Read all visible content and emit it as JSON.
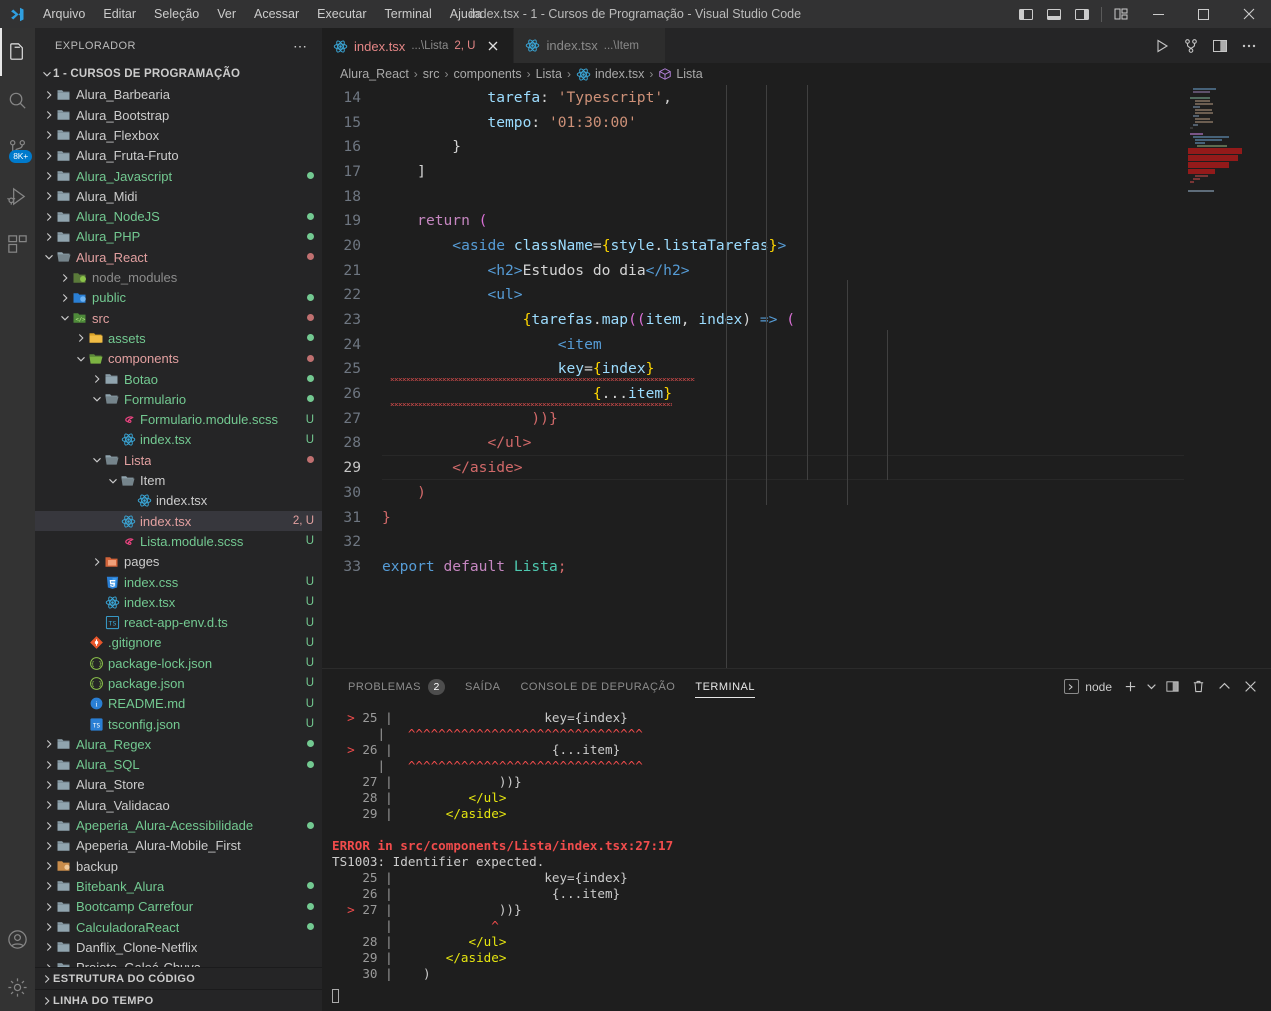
{
  "window": {
    "title": "index.tsx - 1 - Cursos de Programação - Visual Studio Code",
    "menu": [
      "Arquivo",
      "Editar",
      "Seleção",
      "Ver",
      "Acessar",
      "Executar",
      "Terminal",
      "Ajuda"
    ],
    "controls": {
      "panel_left": "toggle-primary-sidebar",
      "panel_bottom": "toggle-panel",
      "panel_right": "toggle-secondary-sidebar",
      "customize_layout": "customize-layout",
      "minimize": "—",
      "maximize": "▢",
      "close": "✕"
    }
  },
  "activitybar": {
    "items": [
      {
        "name": "explorer",
        "active": true,
        "badge": ""
      },
      {
        "name": "search",
        "active": false,
        "badge": ""
      },
      {
        "name": "source-control",
        "active": false,
        "badge": "8K+"
      },
      {
        "name": "run-and-debug",
        "active": false,
        "badge": ""
      },
      {
        "name": "extensions",
        "active": false,
        "badge": ""
      }
    ],
    "bottom": [
      {
        "name": "accounts"
      },
      {
        "name": "manage-settings"
      }
    ]
  },
  "sidebar": {
    "header": "EXPLORADOR",
    "more_actions": "⋯",
    "root": "1 - CURSOS DE PROGRAMAÇÃO",
    "sections": [
      "ESTRUTURA DO CÓDIGO",
      "LINHA DO TEMPO"
    ],
    "tree": [
      {
        "label": "Alura_Barbearia",
        "indent": 0,
        "type": "folder",
        "open": false,
        "color": "#cccccc",
        "status": "",
        "icon": "folder"
      },
      {
        "label": "Alura_Bootstrap",
        "indent": 0,
        "type": "folder",
        "open": false,
        "color": "#cccccc",
        "status": "",
        "icon": "folder"
      },
      {
        "label": "Alura_Flexbox",
        "indent": 0,
        "type": "folder",
        "open": false,
        "color": "#cccccc",
        "status": "",
        "icon": "folder"
      },
      {
        "label": "Alura_Fruta-Fruto",
        "indent": 0,
        "type": "folder",
        "open": false,
        "color": "#cccccc",
        "status": "",
        "icon": "folder"
      },
      {
        "label": "Alura_Javascript",
        "indent": 0,
        "type": "folder",
        "open": false,
        "color": "#73c991",
        "status": "dot-green",
        "icon": "folder"
      },
      {
        "label": "Alura_Midi",
        "indent": 0,
        "type": "folder",
        "open": false,
        "color": "#cccccc",
        "status": "",
        "icon": "folder"
      },
      {
        "label": "Alura_NodeJS",
        "indent": 0,
        "type": "folder",
        "open": false,
        "color": "#73c991",
        "status": "dot-green",
        "icon": "folder"
      },
      {
        "label": "Alura_PHP",
        "indent": 0,
        "type": "folder",
        "open": false,
        "color": "#73c991",
        "status": "dot-green",
        "icon": "folder"
      },
      {
        "label": "Alura_React",
        "indent": 0,
        "type": "folder",
        "open": true,
        "color": "#e2a0a0",
        "status": "dot-red",
        "icon": "folder-open"
      },
      {
        "label": "node_modules",
        "indent": 1,
        "type": "folder",
        "open": false,
        "color": "#8c8c8c",
        "status": "",
        "icon": "folder-node"
      },
      {
        "label": "public",
        "indent": 1,
        "type": "folder",
        "open": false,
        "color": "#73c991",
        "status": "dot-green",
        "icon": "folder-public"
      },
      {
        "label": "src",
        "indent": 1,
        "type": "folder",
        "open": true,
        "color": "#e2a0a0",
        "status": "dot-red",
        "icon": "folder-src"
      },
      {
        "label": "assets",
        "indent": 2,
        "type": "folder",
        "open": false,
        "color": "#73c991",
        "status": "dot-green",
        "icon": "folder-assets"
      },
      {
        "label": "components",
        "indent": 2,
        "type": "folder",
        "open": true,
        "color": "#e2a0a0",
        "status": "dot-red",
        "icon": "folder-components"
      },
      {
        "label": "Botao",
        "indent": 3,
        "type": "folder",
        "open": false,
        "color": "#73c991",
        "status": "dot-green",
        "icon": "folder"
      },
      {
        "label": "Formulario",
        "indent": 3,
        "type": "folder",
        "open": true,
        "color": "#73c991",
        "status": "dot-green",
        "icon": "folder-open"
      },
      {
        "label": "Formulario.module.scss",
        "indent": 4,
        "type": "file",
        "open": false,
        "color": "#73c991",
        "status": "U",
        "icon": "sass"
      },
      {
        "label": "index.tsx",
        "indent": 4,
        "type": "file",
        "open": false,
        "color": "#73c991",
        "status": "U",
        "icon": "react"
      },
      {
        "label": "Lista",
        "indent": 3,
        "type": "folder",
        "open": true,
        "color": "#e2a0a0",
        "status": "dot-red",
        "icon": "folder-open"
      },
      {
        "label": "Item",
        "indent": 4,
        "type": "folder",
        "open": true,
        "color": "#cccccc",
        "status": "",
        "icon": "folder-open"
      },
      {
        "label": "index.tsx",
        "indent": 5,
        "type": "file",
        "open": false,
        "color": "#cccccc",
        "status": "",
        "icon": "react"
      },
      {
        "label": "index.tsx",
        "indent": 4,
        "type": "file",
        "open": false,
        "color": "#e2a0a0",
        "status": "2, U",
        "icon": "react",
        "selected": true
      },
      {
        "label": "Lista.module.scss",
        "indent": 4,
        "type": "file",
        "open": false,
        "color": "#73c991",
        "status": "U",
        "icon": "sass"
      },
      {
        "label": "pages",
        "indent": 3,
        "type": "folder",
        "open": false,
        "color": "#cccccc",
        "status": "",
        "icon": "folder-pages"
      },
      {
        "label": "index.css",
        "indent": 3,
        "type": "file",
        "open": false,
        "color": "#73c991",
        "status": "U",
        "icon": "css"
      },
      {
        "label": "index.tsx",
        "indent": 3,
        "type": "file",
        "open": false,
        "color": "#73c991",
        "status": "U",
        "icon": "react"
      },
      {
        "label": "react-app-env.d.ts",
        "indent": 3,
        "type": "file",
        "open": false,
        "color": "#73c991",
        "status": "U",
        "icon": "ts"
      },
      {
        "label": ".gitignore",
        "indent": 2,
        "type": "file",
        "open": false,
        "color": "#73c991",
        "status": "U",
        "icon": "git"
      },
      {
        "label": "package-lock.json",
        "indent": 2,
        "type": "file",
        "open": false,
        "color": "#73c991",
        "status": "U",
        "icon": "npm"
      },
      {
        "label": "package.json",
        "indent": 2,
        "type": "file",
        "open": false,
        "color": "#73c991",
        "status": "U",
        "icon": "npm"
      },
      {
        "label": "README.md",
        "indent": 2,
        "type": "file",
        "open": false,
        "color": "#73c991",
        "status": "U",
        "icon": "info"
      },
      {
        "label": "tsconfig.json",
        "indent": 2,
        "type": "file",
        "open": false,
        "color": "#73c991",
        "status": "U",
        "icon": "tsconfig"
      },
      {
        "label": "Alura_Regex",
        "indent": 0,
        "type": "folder",
        "open": false,
        "color": "#73c991",
        "status": "dot-green",
        "icon": "folder"
      },
      {
        "label": "Alura_SQL",
        "indent": 0,
        "type": "folder",
        "open": false,
        "color": "#73c991",
        "status": "dot-green",
        "icon": "folder"
      },
      {
        "label": "Alura_Store",
        "indent": 0,
        "type": "folder",
        "open": false,
        "color": "#cccccc",
        "status": "",
        "icon": "folder"
      },
      {
        "label": "Alura_Validacao",
        "indent": 0,
        "type": "folder",
        "open": false,
        "color": "#cccccc",
        "status": "",
        "icon": "folder"
      },
      {
        "label": "Apeperia_Alura-Acessibilidade",
        "indent": 0,
        "type": "folder",
        "open": false,
        "color": "#73c991",
        "status": "dot-green",
        "icon": "folder"
      },
      {
        "label": "Apeperia_Alura-Mobile_First",
        "indent": 0,
        "type": "folder",
        "open": false,
        "color": "#cccccc",
        "status": "",
        "icon": "folder"
      },
      {
        "label": "backup",
        "indent": 0,
        "type": "folder",
        "open": false,
        "color": "#cccccc",
        "status": "",
        "icon": "folder-backup"
      },
      {
        "label": "Bitebank_Alura",
        "indent": 0,
        "type": "folder",
        "open": false,
        "color": "#73c991",
        "status": "dot-green",
        "icon": "folder"
      },
      {
        "label": "Bootcamp Carrefour",
        "indent": 0,
        "type": "folder",
        "open": false,
        "color": "#73c991",
        "status": "dot-green",
        "icon": "folder"
      },
      {
        "label": "CalculadoraReact",
        "indent": 0,
        "type": "folder",
        "open": false,
        "color": "#73c991",
        "status": "dot-green",
        "icon": "folder"
      },
      {
        "label": "Danflix_Clone-Netflix",
        "indent": 0,
        "type": "folder",
        "open": false,
        "color": "#cccccc",
        "status": "",
        "icon": "folder"
      },
      {
        "label": "Projeto_Galoá-Chuva",
        "indent": 0,
        "type": "folder",
        "open": false,
        "color": "#cccccc",
        "status": "",
        "icon": "folder"
      }
    ]
  },
  "editor": {
    "tabs": [
      {
        "label": "index.tsx",
        "desc": "...\\Lista",
        "badge": "2, U",
        "active": true,
        "icon": "react",
        "closable": true
      },
      {
        "label": "index.tsx",
        "desc": "...\\Item",
        "badge": "",
        "active": false,
        "icon": "react",
        "closable": false
      }
    ],
    "actions": [
      "run-icon",
      "source-control-fork-icon",
      "split-editor-icon",
      "more-actions-icon"
    ],
    "breadcrumb": [
      "Alura_React",
      "src",
      "components",
      "Lista",
      "index.tsx",
      "Lista"
    ],
    "breadcrumb_sep": "›",
    "current_line": 29,
    "lines": [
      {
        "n": 14,
        "text": "            tarefa: 'Typescript',"
      },
      {
        "n": 15,
        "text": "            tempo: '01:30:00'"
      },
      {
        "n": 16,
        "text": "        }"
      },
      {
        "n": 17,
        "text": "    ]"
      },
      {
        "n": 18,
        "text": ""
      },
      {
        "n": 19,
        "text": "    return ("
      },
      {
        "n": 20,
        "text": "        <aside className={style.listaTarefas}>"
      },
      {
        "n": 21,
        "text": "            <h2>Estudos do dia</h2>"
      },
      {
        "n": 22,
        "text": "            <ul>"
      },
      {
        "n": 23,
        "text": "                {tarefas.map((item, index) => ("
      },
      {
        "n": 24,
        "text": "                    <item"
      },
      {
        "n": 25,
        "text": "                    key={index}"
      },
      {
        "n": 26,
        "text": "                        {...item}"
      },
      {
        "n": 27,
        "text": "                 ))}"
      },
      {
        "n": 28,
        "text": "            </ul>"
      },
      {
        "n": 29,
        "text": "        </aside>"
      },
      {
        "n": 30,
        "text": "    )"
      },
      {
        "n": 31,
        "text": "}"
      },
      {
        "n": 32,
        "text": ""
      },
      {
        "n": 33,
        "text": "export default Lista;"
      }
    ]
  },
  "panel": {
    "tabs": [
      {
        "label": "PROBLEMAS",
        "count": "2",
        "active": false
      },
      {
        "label": "SAÍDA",
        "count": "",
        "active": false
      },
      {
        "label": "CONSOLE DE DEPURAÇÃO",
        "count": "",
        "active": false
      },
      {
        "label": "TERMINAL",
        "count": "",
        "active": true
      }
    ],
    "terminal_selector": "node",
    "actions": [
      "new-terminal-icon",
      "terminal-dropdown-icon",
      "split-terminal-icon",
      "kill-terminal-icon",
      "maximize-panel-icon",
      "close-panel-icon"
    ],
    "terminal_lines": [
      {
        "segments": [
          {
            "t": "  > ",
            "c": "tm-red"
          },
          {
            "t": "25 ",
            "c": "tm-gray"
          },
          {
            "t": "|",
            "c": "tm-gray"
          },
          {
            "t": "                    key={index}",
            "c": "tm-white"
          }
        ]
      },
      {
        "segments": [
          {
            "t": "      ",
            "c": "tm-gray"
          },
          {
            "t": "|",
            "c": "tm-gray"
          },
          {
            "t": "   ^^^^^^^^^^^^^^^^^^^^^^^^^^^^^^^",
            "c": "tm-red"
          }
        ]
      },
      {
        "segments": [
          {
            "t": "  > ",
            "c": "tm-red"
          },
          {
            "t": "26 ",
            "c": "tm-gray"
          },
          {
            "t": "|",
            "c": "tm-gray"
          },
          {
            "t": "                     {...item}",
            "c": "tm-white"
          }
        ]
      },
      {
        "segments": [
          {
            "t": "      ",
            "c": "tm-gray"
          },
          {
            "t": "|",
            "c": "tm-gray"
          },
          {
            "t": "   ^^^^^^^^^^^^^^^^^^^^^^^^^^^^^^^",
            "c": "tm-red"
          }
        ]
      },
      {
        "segments": [
          {
            "t": "    27 ",
            "c": "tm-gray"
          },
          {
            "t": "|",
            "c": "tm-gray"
          },
          {
            "t": "              ))}",
            "c": "tm-white"
          }
        ]
      },
      {
        "segments": [
          {
            "t": "    28 ",
            "c": "tm-gray"
          },
          {
            "t": "|",
            "c": "tm-gray"
          },
          {
            "t": "          </ul>",
            "c": "tm-yel"
          }
        ]
      },
      {
        "segments": [
          {
            "t": "    29 ",
            "c": "tm-gray"
          },
          {
            "t": "|",
            "c": "tm-gray"
          },
          {
            "t": "       </aside>",
            "c": "tm-yel"
          }
        ]
      },
      {
        "segments": [
          {
            "t": "",
            "c": "tm-gray"
          }
        ]
      },
      {
        "segments": [
          {
            "t": "ERROR in src/components/Lista/index.tsx:27:17",
            "c": "tm-redb"
          }
        ]
      },
      {
        "segments": [
          {
            "t": "TS1003: Identifier expected.",
            "c": "tm-white"
          }
        ]
      },
      {
        "segments": [
          {
            "t": "    25 ",
            "c": "tm-gray"
          },
          {
            "t": "|",
            "c": "tm-gray"
          },
          {
            "t": "                    key={index}",
            "c": "tm-white"
          }
        ]
      },
      {
        "segments": [
          {
            "t": "    26 ",
            "c": "tm-gray"
          },
          {
            "t": "|",
            "c": "tm-gray"
          },
          {
            "t": "                     {...item}",
            "c": "tm-white"
          }
        ]
      },
      {
        "segments": [
          {
            "t": "  > ",
            "c": "tm-red"
          },
          {
            "t": "27 ",
            "c": "tm-gray"
          },
          {
            "t": "|",
            "c": "tm-gray"
          },
          {
            "t": "              ))}",
            "c": "tm-white"
          }
        ]
      },
      {
        "segments": [
          {
            "t": "       ",
            "c": "tm-gray"
          },
          {
            "t": "|",
            "c": "tm-gray"
          },
          {
            "t": "             ^",
            "c": "tm-red"
          }
        ]
      },
      {
        "segments": [
          {
            "t": "    28 ",
            "c": "tm-gray"
          },
          {
            "t": "|",
            "c": "tm-gray"
          },
          {
            "t": "          </ul>",
            "c": "tm-yel"
          }
        ]
      },
      {
        "segments": [
          {
            "t": "    29 ",
            "c": "tm-gray"
          },
          {
            "t": "|",
            "c": "tm-gray"
          },
          {
            "t": "       </aside>",
            "c": "tm-yel"
          }
        ]
      },
      {
        "segments": [
          {
            "t": "    30 ",
            "c": "tm-gray"
          },
          {
            "t": "|",
            "c": "tm-gray"
          },
          {
            "t": "    )",
            "c": "tm-white"
          }
        ]
      }
    ]
  },
  "colors": {
    "accent": "#007acc",
    "error": "#f14c4c",
    "modified_green": "#73c991",
    "conflict_red": "#e2a0a0",
    "editor_bg": "#1e1e1e",
    "sidebar_bg": "#252526",
    "titlebar_bg": "#323233"
  }
}
